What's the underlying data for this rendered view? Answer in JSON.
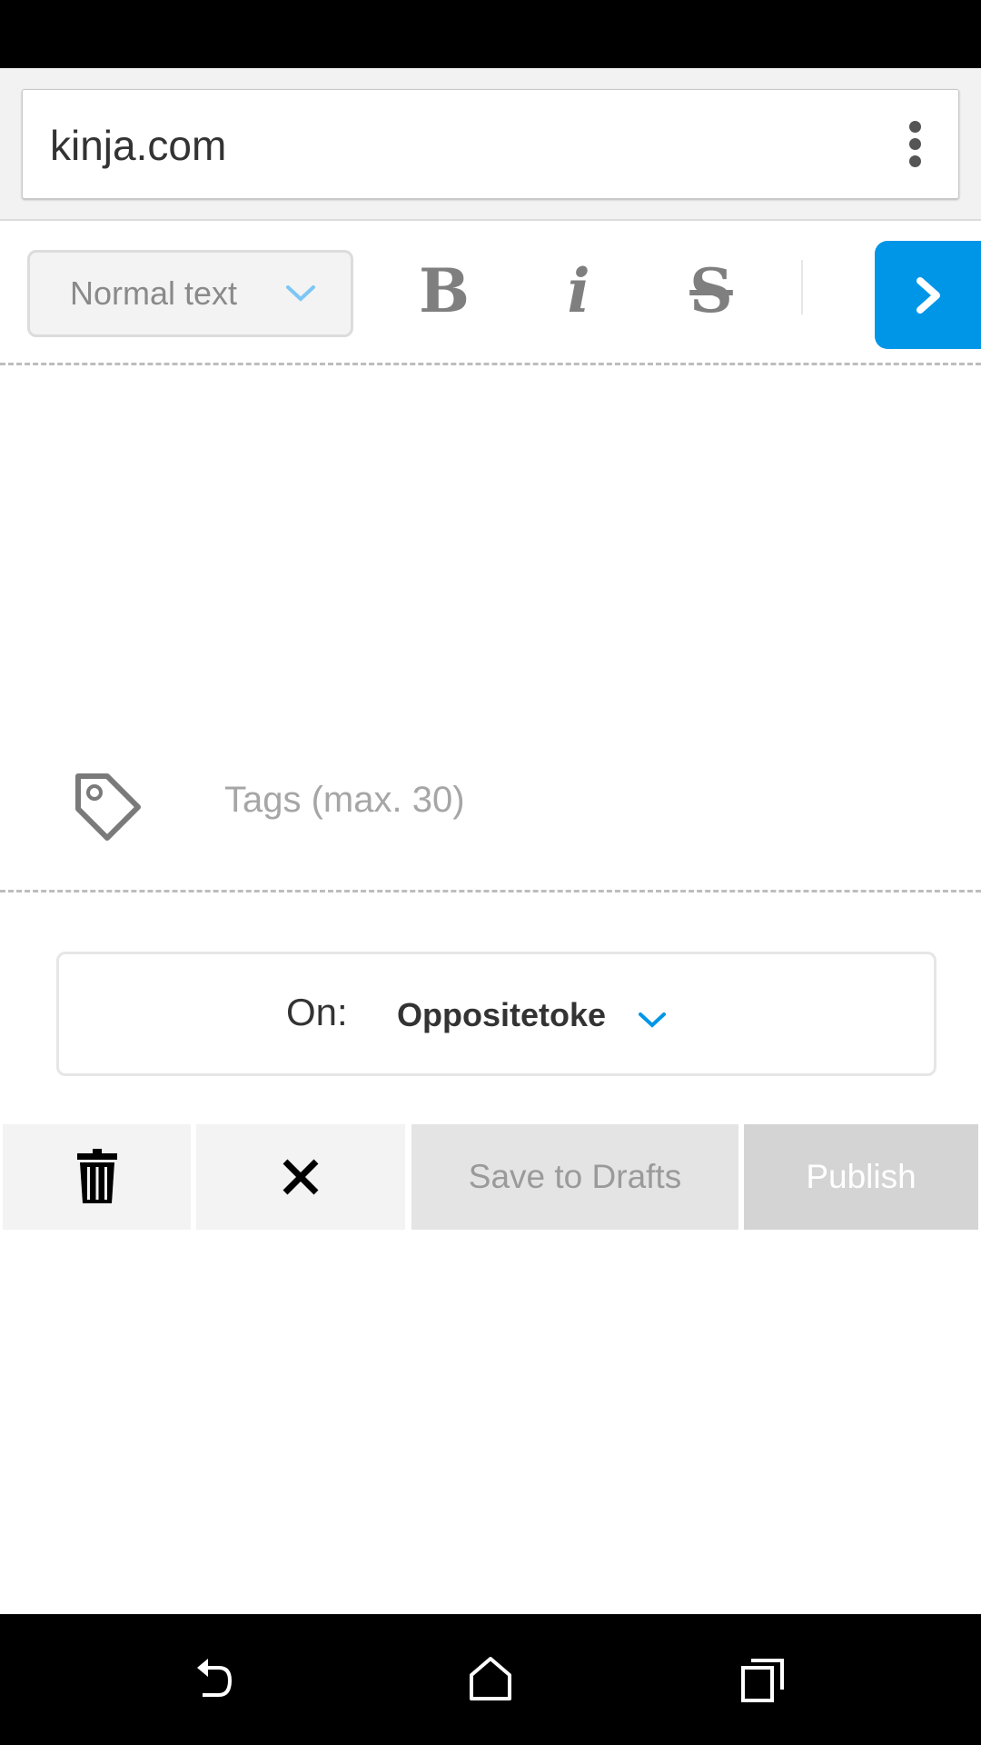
{
  "status_bar": {},
  "browser": {
    "url": "kinja.com",
    "menu_icon": "more-vertical-icon"
  },
  "toolbar": {
    "format_select": {
      "value": "Normal text",
      "icon": "chevron-down-icon"
    },
    "bold_label": "B",
    "italic_label": "i",
    "strike_label": "S",
    "next_icon": "chevron-right-icon"
  },
  "tags": {
    "icon": "tag-icon",
    "placeholder": "Tags (max. 30)"
  },
  "blog_select": {
    "label": "On:",
    "value": "Oppositetoke",
    "icon": "chevron-down-icon"
  },
  "actions": {
    "delete_icon": "trash-icon",
    "close_icon": "close-icon",
    "save_label": "Save to Drafts",
    "publish_label": "Publish"
  },
  "nav_bar": {
    "back_icon": "back-icon",
    "home_icon": "home-icon",
    "recents_icon": "recents-icon"
  },
  "colors": {
    "accent": "#0096E8",
    "save_bg": "#E4E4E4",
    "publish_bg": "#D4D4D4"
  }
}
